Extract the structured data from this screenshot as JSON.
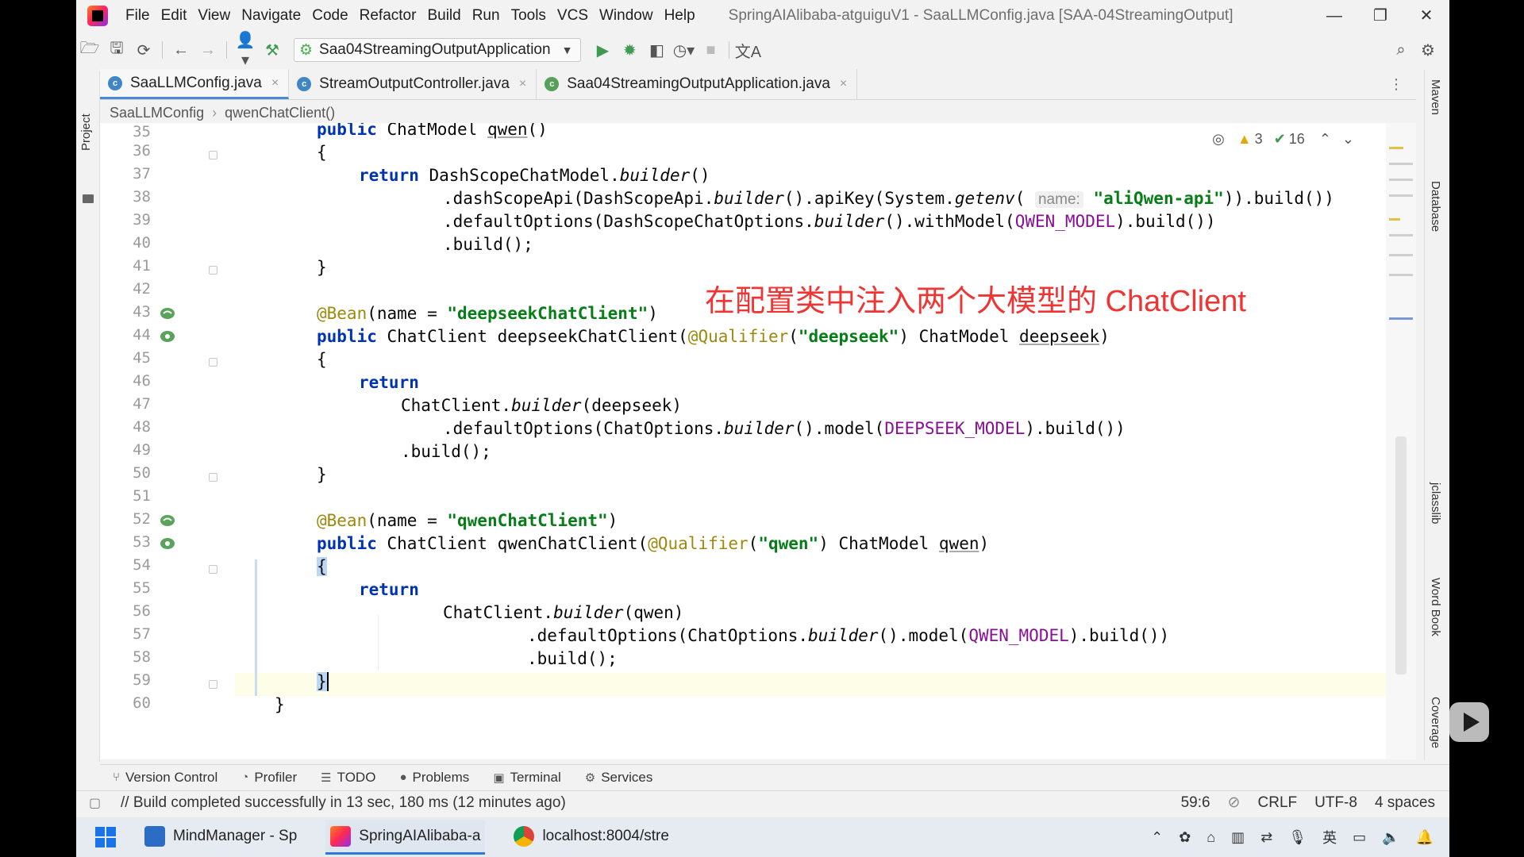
{
  "titlebar": {
    "menu": [
      "File",
      "Edit",
      "View",
      "Navigate",
      "Code",
      "Refactor",
      "Build",
      "Run",
      "Tools",
      "VCS",
      "Window",
      "Help"
    ],
    "window_title": "SpringAIAlibaba-atguiguV1 - SaaLLMConfig.java [SAA-04StreamingOutput]",
    "controls": [
      "—",
      "❐",
      "✕"
    ]
  },
  "toolbar": {
    "run_config": "Saa04StreamingOutputApplication"
  },
  "left_strip": {
    "project_label": "Project"
  },
  "tabs": [
    {
      "label": "SaaLLMConfig.java",
      "active": true
    },
    {
      "label": "StreamOutputController.java",
      "active": false
    },
    {
      "label": "Saa04StreamingOutputApplication.java",
      "active": false
    }
  ],
  "breadcrumb": [
    "SaaLLMConfig",
    "qwenChatClient()"
  ],
  "inspections": {
    "warnings": "3",
    "checks": "16"
  },
  "overlay_text": "在配置类中注入两个大模型的 ChatClient",
  "code": {
    "line_numbers": [
      "35",
      "36",
      "37",
      "38",
      "39",
      "40",
      "41",
      "42",
      "43",
      "44",
      "45",
      "46",
      "47",
      "48",
      "49",
      "50",
      "51",
      "52",
      "53",
      "54",
      "55",
      "56",
      "57",
      "58",
      "59",
      "60"
    ],
    "l35_kw": "public",
    "l35_rest": " ChatModel ",
    "l35_name": "qwen",
    "l35_tail": "()",
    "brace_open": "{",
    "brace_close": "}",
    "return_kw": "return",
    "l37_a": " DashScopeChatModel.",
    "l37_b": "builder",
    "l37_c": "()",
    "l38_a": ".dashScopeApi(DashScopeApi.",
    "l38_b": "builder",
    "l38_c": "().apiKey(System.",
    "l38_d": "getenv",
    "l38_e": "( ",
    "l38_hint": "name:",
    "l38_str": "\"aliQwen-api\"",
    "l38_f": ")).build())",
    "l39_a": ".defaultOptions(DashScopeChatOptions.",
    "l39_b": "builder",
    "l39_c": "().withModel(",
    "l39_const": "QWEN_MODEL",
    "l39_d": ").build())",
    "l40": ".build();",
    "bean_ann": "@Bean",
    "l43_a": "(name = ",
    "l43_str": "\"deepseekChatClient\"",
    "l43_b": ")",
    "l44_kw": "public",
    "l44_a": " ChatClient deepseekChatClient(",
    "l44_ann": "@Qualifier",
    "l44_b": "(",
    "l44_str": "\"deepseek\"",
    "l44_c": ") ChatModel ",
    "l44_d": "deepseek",
    "l44_e": ")",
    "l47_a": "ChatClient.",
    "l47_b": "builder",
    "l47_c": "(deepseek)",
    "l48_a": ".defaultOptions(ChatOptions.",
    "l48_b": "builder",
    "l48_c": "().model(",
    "l48_const": "DEEPSEEK_MODEL",
    "l48_d": ").build())",
    "l49": ".build();",
    "l52_a": "(name = ",
    "l52_str": "\"qwenChatClient\"",
    "l52_b": ")",
    "l53_kw": "public",
    "l53_a": " ChatClient qwenChatClient(",
    "l53_ann": "@Qualifier",
    "l53_b": "(",
    "l53_str": "\"qwen\"",
    "l53_c": ") ChatModel ",
    "l53_d": "qwen",
    "l53_e": ")",
    "l56_a": "ChatClient.",
    "l56_b": "builder",
    "l56_c": "(qwen)",
    "l57_a": ".defaultOptions(ChatOptions.",
    "l57_b": "builder",
    "l57_c": "().model(",
    "l57_const": "QWEN_MODEL",
    "l57_d": ").build())",
    "l58": ".build();"
  },
  "right_strip": [
    "Maven",
    "Database",
    "jclasslib",
    "Word Book",
    "Coverage"
  ],
  "bottom_tools": [
    {
      "icon": "version-control-icon",
      "glyph": "⑂",
      "label": "Version Control"
    },
    {
      "icon": "profiler-icon",
      "glyph": "◔",
      "label": "Profiler"
    },
    {
      "icon": "todo-icon",
      "glyph": "☰",
      "label": "TODO"
    },
    {
      "icon": "problems-icon",
      "glyph": "●",
      "label": "Problems"
    },
    {
      "icon": "terminal-icon",
      "glyph": "▣",
      "label": "Terminal"
    },
    {
      "icon": "services-icon",
      "glyph": "⚙",
      "label": "Services"
    }
  ],
  "statusbar": {
    "message": "// Build completed successfully in 13 sec, 180 ms (12 minutes ago)",
    "position": "59:6",
    "line_sep": "CRLF",
    "encoding": "UTF-8",
    "indent": "4 spaces"
  },
  "taskbar": {
    "apps": [
      {
        "label": "MindManager - Sp",
        "active": false,
        "color": "#2b6cc4"
      },
      {
        "label": "SpringAIAlibaba-a",
        "active": true,
        "color": "#e0245e"
      },
      {
        "label": "localhost:8004/stre",
        "active": false,
        "color": "#e8a317"
      }
    ],
    "tray_input": "英"
  },
  "colors": {
    "accent": "#4a88d8",
    "keyword": "#0033b3",
    "string": "#067d17",
    "annotation": "#9e880d",
    "constant": "#871094",
    "overlay": "#ef3434"
  }
}
